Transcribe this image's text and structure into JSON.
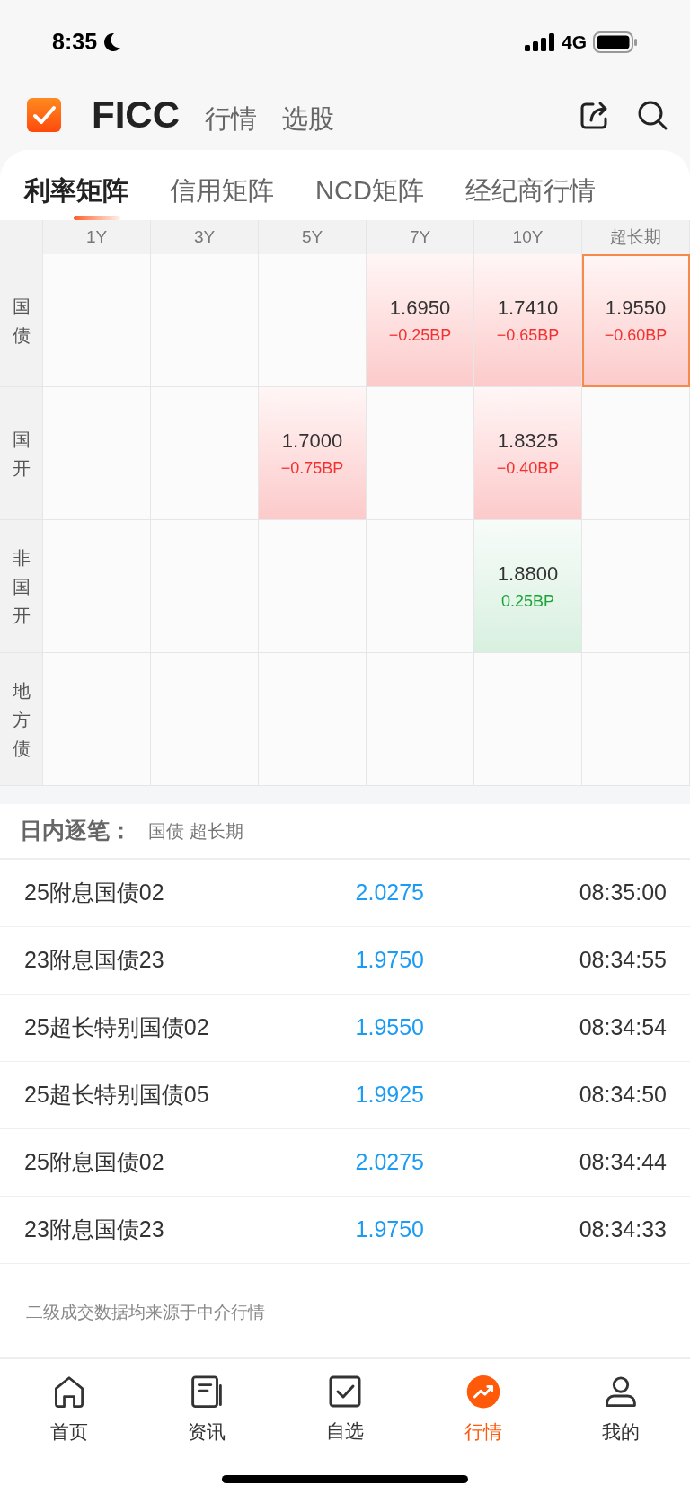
{
  "status_bar": {
    "time": "8:35",
    "network": "4G"
  },
  "header": {
    "tabs": [
      {
        "label": "FICC",
        "selected": true
      },
      {
        "label": "行情",
        "selected": false
      },
      {
        "label": "选股",
        "selected": false
      }
    ]
  },
  "matrix_tabs": [
    {
      "label": "利率矩阵",
      "selected": true
    },
    {
      "label": "信用矩阵",
      "selected": false
    },
    {
      "label": "NCD矩阵",
      "selected": false
    },
    {
      "label": "经纪商行情",
      "selected": false
    }
  ],
  "matrix": {
    "columns": [
      "1Y",
      "3Y",
      "5Y",
      "7Y",
      "10Y",
      "超长期"
    ],
    "rows": [
      {
        "label": "国债",
        "cells": [
          {
            "kind": "empty",
            "selected": false
          },
          {
            "kind": "empty",
            "selected": false
          },
          {
            "kind": "empty",
            "selected": false
          },
          {
            "kind": "fall",
            "yield": "1.6950",
            "change": "−0.25BP",
            "selected": false
          },
          {
            "kind": "fall",
            "yield": "1.7410",
            "change": "−0.65BP",
            "selected": false
          },
          {
            "kind": "fall",
            "yield": "1.9550",
            "change": "−0.60BP",
            "selected": true
          }
        ]
      },
      {
        "label": "国开",
        "cells": [
          {
            "kind": "empty",
            "selected": false
          },
          {
            "kind": "empty",
            "selected": false
          },
          {
            "kind": "fall",
            "yield": "1.7000",
            "change": "−0.75BP",
            "selected": false
          },
          {
            "kind": "empty",
            "selected": false
          },
          {
            "kind": "fall",
            "yield": "1.8325",
            "change": "−0.40BP",
            "selected": false
          },
          {
            "kind": "empty",
            "selected": false
          }
        ]
      },
      {
        "label": "非国开",
        "cells": [
          {
            "kind": "empty",
            "selected": false
          },
          {
            "kind": "empty",
            "selected": false
          },
          {
            "kind": "empty",
            "selected": false
          },
          {
            "kind": "empty",
            "selected": false
          },
          {
            "kind": "rise",
            "yield": "1.8800",
            "change": "0.25BP",
            "selected": false
          },
          {
            "kind": "empty",
            "selected": false
          }
        ]
      },
      {
        "label": "地方债",
        "cells": [
          {
            "kind": "empty",
            "selected": false
          },
          {
            "kind": "empty",
            "selected": false
          },
          {
            "kind": "empty",
            "selected": false
          },
          {
            "kind": "empty",
            "selected": false
          },
          {
            "kind": "empty",
            "selected": false
          },
          {
            "kind": "empty",
            "selected": false
          }
        ]
      }
    ]
  },
  "trades": {
    "title": "日内逐笔：",
    "filter": "国债 超长期",
    "rows": [
      {
        "name": "25附息国债02",
        "yield": "2.0275",
        "time": "08:35:00"
      },
      {
        "name": "23附息国债23",
        "yield": "1.9750",
        "time": "08:34:55"
      },
      {
        "name": "25超长特别国债02",
        "yield": "1.9550",
        "time": "08:34:54"
      },
      {
        "name": "25超长特别国债05",
        "yield": "1.9925",
        "time": "08:34:50"
      },
      {
        "name": "25附息国债02",
        "yield": "2.0275",
        "time": "08:34:44"
      },
      {
        "name": "23附息国债23",
        "yield": "1.9750",
        "time": "08:34:33"
      }
    ]
  },
  "footnote": "二级成交数据均来源于中介行情",
  "bottom_nav": [
    {
      "kind": "home",
      "label": "首页",
      "selected": false
    },
    {
      "kind": "news",
      "label": "资讯",
      "selected": false
    },
    {
      "kind": "watchlist",
      "label": "自选",
      "selected": false
    },
    {
      "kind": "market",
      "label": "行情",
      "selected": true
    },
    {
      "kind": "profile",
      "label": "我的",
      "selected": false
    }
  ]
}
